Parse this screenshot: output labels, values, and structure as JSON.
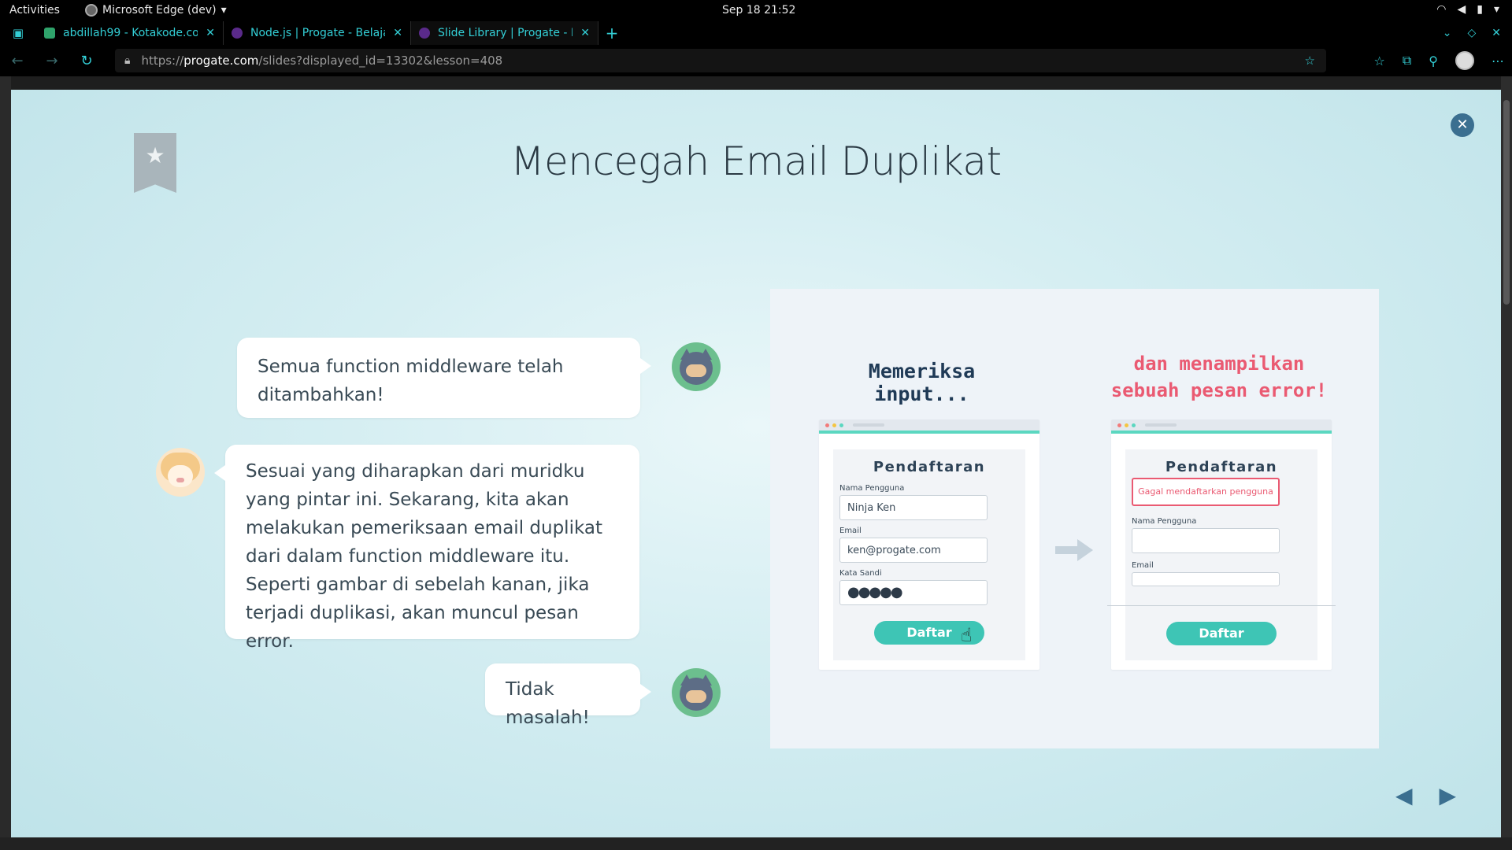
{
  "system": {
    "activities": "Activities",
    "app_name": "Microsoft Edge (dev)",
    "clock": "Sep 18  21:52"
  },
  "browser": {
    "tabs": [
      {
        "title": "abdillah99 - Kotakode.co",
        "favicon": "sheet-icon"
      },
      {
        "title": "Node.js | Progate - Belaja",
        "favicon": "progate-icon"
      },
      {
        "title": "Slide Library | Progate - B",
        "favicon": "progate-icon",
        "active": true
      }
    ],
    "url_prefix": "https://",
    "url_host": "progate.com",
    "url_path": "/slides?displayed_id=13302&lesson=408"
  },
  "slide": {
    "title": "Mencegah Email Duplikat",
    "messages": [
      {
        "speaker": "ninja",
        "side": "right",
        "text": "Semua function middleware telah ditambahkan!"
      },
      {
        "speaker": "sheep",
        "side": "left",
        "text": "Sesuai yang diharapkan dari muridku yang pintar ini. Sekarang, kita akan melakukan pemeriksaan email duplikat dari dalam function middleware itu. Seperti gambar di sebelah kanan, jika terjadi duplikasi, akan muncul pesan error."
      },
      {
        "speaker": "ninja",
        "side": "right",
        "text": "Tidak masalah!"
      }
    ],
    "illustration": {
      "left_heading": "Memeriksa input...",
      "right_heading": "dan menampilkan sebuah pesan error!",
      "form_title": "Pendaftaran",
      "label_username": "Nama Pengguna",
      "label_email": "Email",
      "label_password": "Kata Sandi",
      "value_username": "Ninja Ken",
      "value_email": "ken@progate.com",
      "value_password": "●●●●●",
      "button": "Daftar",
      "error": "Gagal mendaftarkan pengguna"
    },
    "colors": {
      "accent": "#3ec5b5",
      "error": "#ea5a72",
      "title": "#2b3a44"
    }
  }
}
